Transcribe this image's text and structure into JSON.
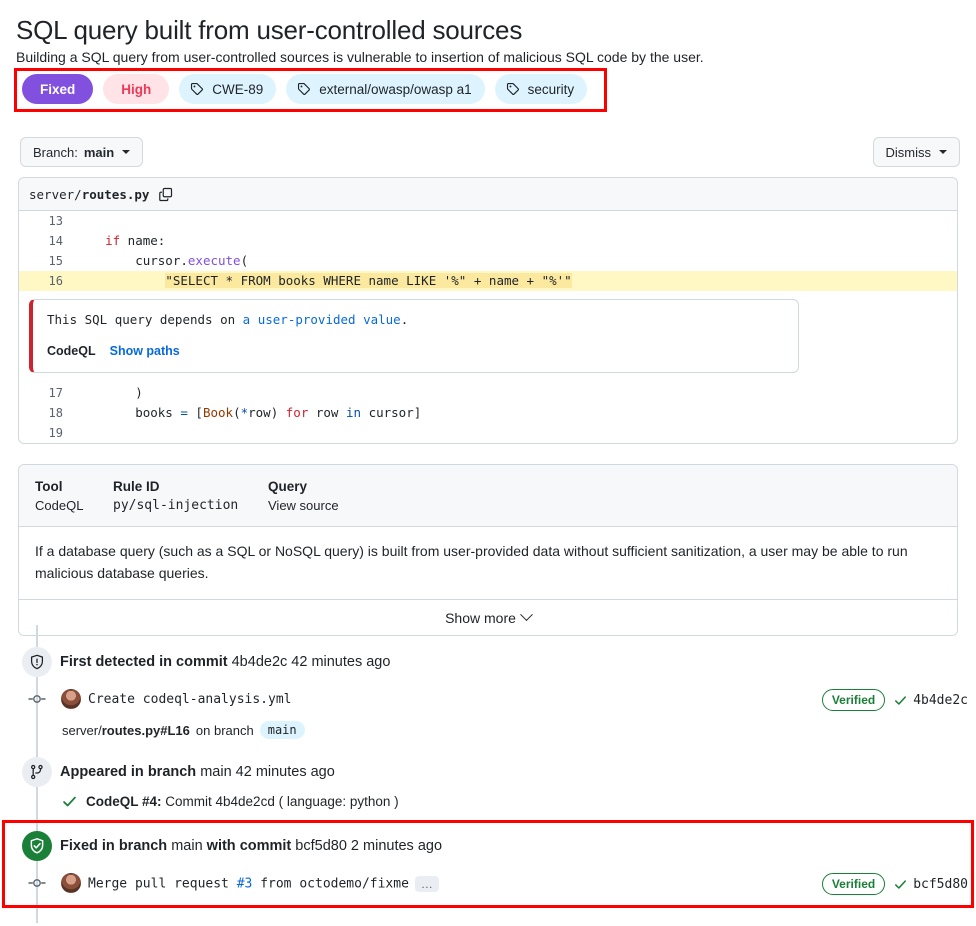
{
  "alert": {
    "title": "SQL query built from user-controlled sources",
    "description": "Building a SQL query from user-controlled sources is vulnerable to insertion of malicious SQL code by the user."
  },
  "badges": {
    "state": "Fixed",
    "severity": "High",
    "tags": [
      "CWE-89",
      "external/owasp/owasp a1",
      "security"
    ]
  },
  "toolbar": {
    "branch_prefix": "Branch: ",
    "branch_name": "main",
    "dismiss_label": "Dismiss"
  },
  "code": {
    "file_prefix": "server/",
    "file_name": "routes.py",
    "lines_before": [
      {
        "num": "13",
        "text": ""
      },
      {
        "num": "14",
        "text": "    if name:"
      },
      {
        "num": "15",
        "text": "        cursor.execute("
      },
      {
        "num": "16",
        "text": "            \"SELECT * FROM books WHERE name LIKE '%\" + name + \"%'\""
      }
    ],
    "lines_after": [
      {
        "num": "17",
        "text": "        )"
      },
      {
        "num": "18",
        "text": "        books = [Book(*row) for row in cursor]"
      },
      {
        "num": "19",
        "text": ""
      }
    ],
    "callout": {
      "text_before": "This SQL query depends on ",
      "link": "a user-provided value",
      "text_after": ".",
      "tool": "CodeQL",
      "show_paths": "Show paths"
    }
  },
  "details": {
    "tool_label": "Tool",
    "tool_value": "CodeQL",
    "rule_label": "Rule ID",
    "rule_value": "py/sql-injection",
    "query_label": "Query",
    "query_value": "View source",
    "body": "If a database query (such as a SQL or NoSQL query) is built from user-provided data without sufficient sanitization, a user may be able to run malicious database queries.",
    "show_more": "Show more"
  },
  "timeline": {
    "detected": {
      "heading_bold": "First detected in commit",
      "heading_rest": " 4b4de2c 42 minutes ago",
      "commit_message": "Create codeql-analysis.yml",
      "sub_path_prefix": "server/",
      "sub_path_bold": "routes.py#L16",
      "sub_on_branch": "on branch",
      "sub_branch": "main",
      "verified": "Verified",
      "sha": "4b4de2c"
    },
    "appeared": {
      "heading_bold": "Appeared in branch",
      "heading_rest": " main 42 minutes ago",
      "check_bold": "CodeQL #4:",
      "check_rest": " Commit 4b4de2cd ( language: python )"
    },
    "fixed": {
      "heading_p1": "Fixed in branch",
      "heading_p2": " main ",
      "heading_p3": "with commit",
      "heading_p4": " bcf5d80 2 minutes ago",
      "commit_prefix": "Merge pull request ",
      "commit_link": "#3",
      "commit_suffix": " from octodemo/fixme",
      "ellipsis": "…",
      "verified": "Verified",
      "sha": "bcf5d80"
    }
  },
  "icons": {
    "tag": "tag-icon",
    "copy": "copy-icon",
    "shield": "shield-icon",
    "branch": "branch-icon",
    "shield-check": "shield-check-icon",
    "commit": "commit-dot-icon",
    "check": "check-icon"
  },
  "colors": {
    "fixed_purple": "#8250df",
    "severity_red": "#eb3b5a",
    "tag_blue_bg": "#ddf4ff",
    "annotation_red": "#fd0000",
    "verified_green": "#1a7f37",
    "link_blue": "#0969da",
    "highlight_yellow": "#fff8c5"
  }
}
